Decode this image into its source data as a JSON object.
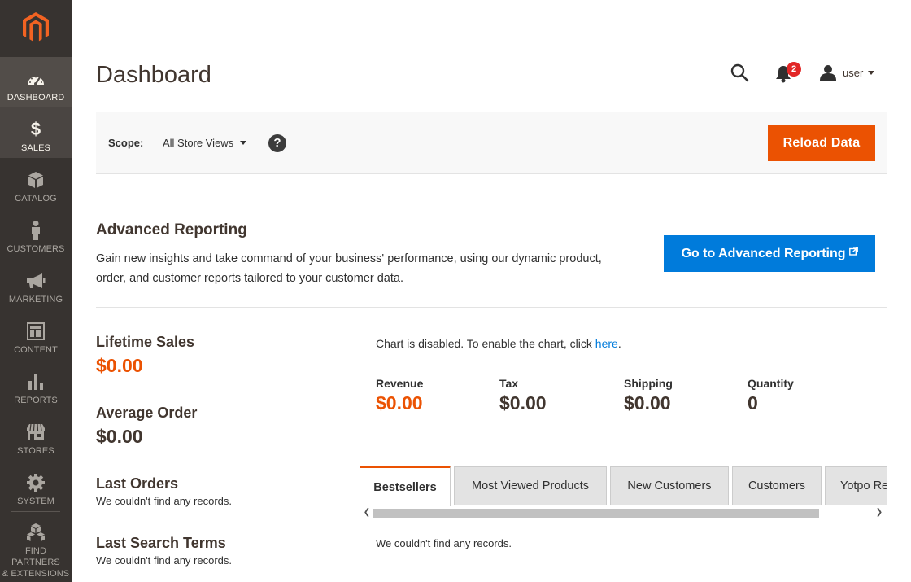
{
  "sidebar": {
    "logo": "magento-logo",
    "items": [
      {
        "label": "DASHBOARD",
        "icon": "dashboard-gauge-icon"
      },
      {
        "label": "SALES",
        "icon": "dollar-icon"
      },
      {
        "label": "CATALOG",
        "icon": "box-icon"
      },
      {
        "label": "CUSTOMERS",
        "icon": "person-icon"
      },
      {
        "label": "MARKETING",
        "icon": "megaphone-icon"
      },
      {
        "label": "CONTENT",
        "icon": "layout-icon"
      },
      {
        "label": "REPORTS",
        "icon": "bar-chart-icon"
      },
      {
        "label": "STORES",
        "icon": "store-icon"
      },
      {
        "label": "SYSTEM",
        "icon": "gear-icon"
      },
      {
        "label_line1": "FIND PARTNERS",
        "label_line2": "& EXTENSIONS",
        "icon": "cubes-icon"
      }
    ]
  },
  "header": {
    "title": "Dashboard",
    "notification_count": "2",
    "user": "user"
  },
  "scope": {
    "label": "Scope:",
    "value": "All Store Views",
    "help": "?",
    "reload_label": "Reload Data"
  },
  "advanced_reporting": {
    "title": "Advanced Reporting",
    "text": "Gain new insights and take command of your business' performance, using our dynamic product, order, and customer reports tailored to your customer data.",
    "button_label": "Go to Advanced Reporting"
  },
  "stats": {
    "lifetime_sales_title": "Lifetime Sales",
    "lifetime_sales_value": "$0.00",
    "average_order_title": "Average Order",
    "average_order_value": "$0.00",
    "last_orders_title": "Last Orders",
    "last_orders_text": "We couldn't find any records.",
    "last_search_title": "Last Search Terms",
    "last_search_text": "We couldn't find any records."
  },
  "chart": {
    "note_prefix": "Chart is disabled. To enable the chart, click ",
    "note_link": "here",
    "note_suffix": "."
  },
  "totals": [
    {
      "label": "Revenue",
      "value": "$0.00",
      "color": "#eb5202"
    },
    {
      "label": "Tax",
      "value": "$0.00",
      "color": "#41362f"
    },
    {
      "label": "Shipping",
      "value": "$0.00",
      "color": "#41362f"
    },
    {
      "label": "Quantity",
      "value": "0",
      "color": "#41362f"
    }
  ],
  "tabs": [
    {
      "label": "Bestsellers",
      "active": true
    },
    {
      "label": "Most Viewed Products",
      "active": false
    },
    {
      "label": "New Customers",
      "active": false
    },
    {
      "label": "Customers",
      "active": false
    },
    {
      "label": "Yotpo Re",
      "active": false
    }
  ],
  "tab_content": "We couldn't find any records.",
  "colors": {
    "sidebar_bg": "#373330",
    "accent_orange": "#eb5202",
    "accent_blue": "#007bdb"
  }
}
